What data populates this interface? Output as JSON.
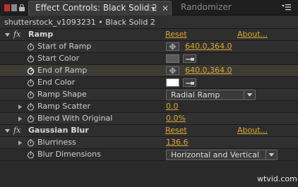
{
  "tabs": {
    "active_label": "Effect Controls: Black Solid 2",
    "inactive_label": "Randomizer"
  },
  "breadcrumb": "shutterstock_v1093231 • Black Solid 2",
  "effects": {
    "ramp": {
      "name": "Ramp",
      "reset": "Reset",
      "about": "About...",
      "start_of_ramp": {
        "label": "Start of Ramp",
        "value": "640.0,364.0"
      },
      "start_color": {
        "label": "Start Color",
        "color": "#5a5a5a"
      },
      "end_of_ramp": {
        "label": "End of Ramp",
        "value": "640.0,364.0"
      },
      "end_color": {
        "label": "End Color",
        "color": "#ffffff"
      },
      "ramp_shape": {
        "label": "Ramp Shape",
        "value": "Radial Ramp"
      },
      "ramp_scatter": {
        "label": "Ramp Scatter",
        "value": "0.0"
      },
      "blend_with_original": {
        "label": "Blend With Original",
        "value": "0.0%"
      }
    },
    "gaussian_blur": {
      "name": "Gaussian Blur",
      "reset": "Reset",
      "about": "About...",
      "blurriness": {
        "label": "Blurriness",
        "value": "136.6"
      },
      "blur_dimensions": {
        "label": "Blur Dimensions",
        "value": "Horizontal and Vertical"
      }
    }
  },
  "fx_symbol": "fx",
  "watermark": "wtvid.com",
  "colors": {
    "accent": "#e1a52b",
    "panel_bg": "#2a2a2a"
  }
}
